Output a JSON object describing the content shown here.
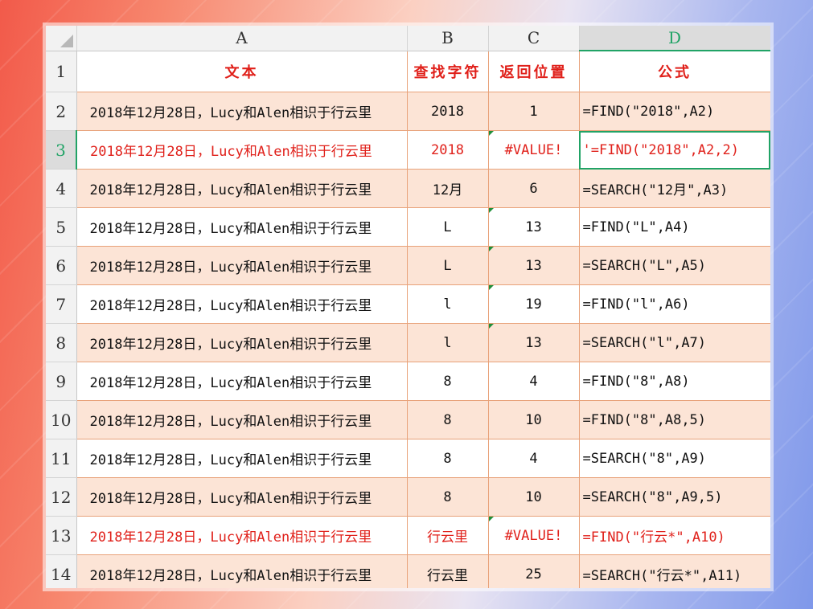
{
  "columns": [
    {
      "label": "A",
      "selected": false
    },
    {
      "label": "B",
      "selected": false
    },
    {
      "label": "C",
      "selected": false
    },
    {
      "label": "D",
      "selected": true
    }
  ],
  "header_row": {
    "num": "1",
    "a": "文本",
    "b": "查找字符",
    "c": "返回位置",
    "d": "公式"
  },
  "rows": [
    {
      "num": "2",
      "a": "2018年12月28日，Lucy和Alen相识于行云里",
      "b": "2018",
      "c": "1",
      "d": "=FIND(\"2018\",A2)",
      "shaded": true,
      "error": false,
      "c_flag": false
    },
    {
      "num": "3",
      "a": "2018年12月28日，Lucy和Alen相识于行云里",
      "b": "2018",
      "c": "#VALUE!",
      "d": "'=FIND(\"2018\",A2,2)",
      "shaded": false,
      "error": true,
      "c_flag": true
    },
    {
      "num": "4",
      "a": "2018年12月28日，Lucy和Alen相识于行云里",
      "b": "12月",
      "c": "6",
      "d": "=SEARCH(\"12月\",A3)",
      "shaded": true,
      "error": false,
      "c_flag": false
    },
    {
      "num": "5",
      "a": "2018年12月28日，Lucy和Alen相识于行云里",
      "b": "L",
      "c": "13",
      "d": "=FIND(\"L\",A4)",
      "shaded": false,
      "error": false,
      "c_flag": true
    },
    {
      "num": "6",
      "a": "2018年12月28日，Lucy和Alen相识于行云里",
      "b": "L",
      "c": "13",
      "d": "=SEARCH(\"L\",A5)",
      "shaded": true,
      "error": false,
      "c_flag": true
    },
    {
      "num": "7",
      "a": "2018年12月28日，Lucy和Alen相识于行云里",
      "b": "l",
      "c": "19",
      "d": "=FIND(\"l\",A6)",
      "shaded": false,
      "error": false,
      "c_flag": true
    },
    {
      "num": "8",
      "a": "2018年12月28日，Lucy和Alen相识于行云里",
      "b": "l",
      "c": "13",
      "d": "=SEARCH(\"l\",A7)",
      "shaded": true,
      "error": false,
      "c_flag": true
    },
    {
      "num": "9",
      "a": "2018年12月28日，Lucy和Alen相识于行云里",
      "b": "8",
      "c": "4",
      "d": "=FIND(\"8\",A8)",
      "shaded": false,
      "error": false,
      "c_flag": false
    },
    {
      "num": "10",
      "a": "2018年12月28日，Lucy和Alen相识于行云里",
      "b": "8",
      "c": "10",
      "d": "=FIND(\"8\",A8,5)",
      "shaded": true,
      "error": false,
      "c_flag": false
    },
    {
      "num": "11",
      "a": "2018年12月28日，Lucy和Alen相识于行云里",
      "b": "8",
      "c": "4",
      "d": "=SEARCH(\"8\",A9)",
      "shaded": false,
      "error": false,
      "c_flag": false
    },
    {
      "num": "12",
      "a": "2018年12月28日，Lucy和Alen相识于行云里",
      "b": "8",
      "c": "10",
      "d": "=SEARCH(\"8\",A9,5)",
      "shaded": true,
      "error": false,
      "c_flag": false
    },
    {
      "num": "13",
      "a": "2018年12月28日，Lucy和Alen相识于行云里",
      "b": "行云里",
      "c": "#VALUE!",
      "d": "=FIND(\"行云*\",A10)",
      "shaded": false,
      "error": true,
      "c_flag": true
    },
    {
      "num": "14",
      "a": "2018年12月28日，Lucy和Alen相识于行云里",
      "b": "行云里",
      "c": "25",
      "d": "=SEARCH(\"行云*\",A11)",
      "shaded": true,
      "error": false,
      "c_flag": false
    }
  ],
  "active_cell": {
    "row": "3",
    "col": "D"
  },
  "colors": {
    "header_text": "#e0201a",
    "shaded_row": "#fce4d6",
    "grid_line": "#e8a27a",
    "selection": "#21a366",
    "error_text": "#e0201a"
  }
}
